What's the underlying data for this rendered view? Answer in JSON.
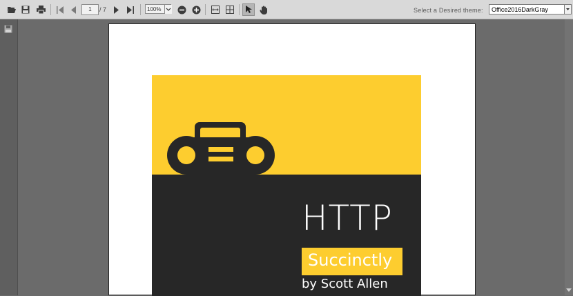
{
  "toolbar": {
    "page_current": "1",
    "page_total": "/ 7",
    "zoom_value": "100%",
    "theme_label": "Select a Desired theme:",
    "theme_value": "Office2016DarkGray"
  },
  "document": {
    "title": "HTTP",
    "series_badge": "Succinctly",
    "author": "by Scott Allen"
  },
  "colors": {
    "cover_yellow": "#fdcd2f",
    "cover_dark": "#272727"
  },
  "icons": [
    "open-icon",
    "save-icon",
    "print-icon",
    "first-page-icon",
    "previous-page-icon",
    "next-page-icon",
    "last-page-icon",
    "zoom-out-icon",
    "zoom-in-icon",
    "fit-width-icon",
    "fit-page-icon",
    "select-tool-icon",
    "pan-tool-icon",
    "save-thumbnail-icon",
    "radio-icon"
  ]
}
